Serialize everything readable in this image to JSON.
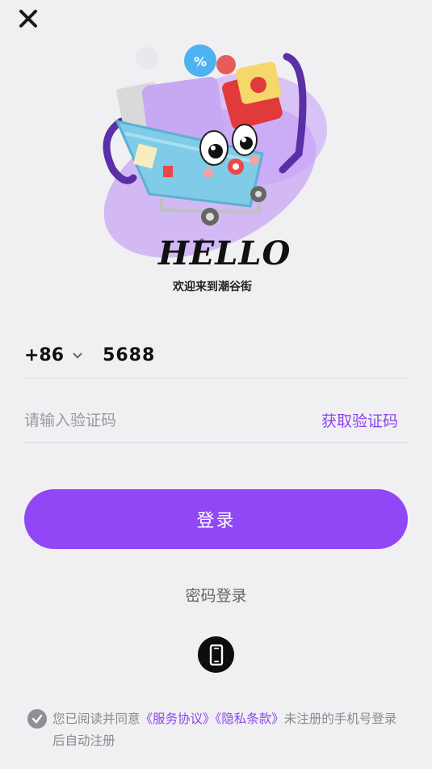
{
  "hero": {
    "hello_word": "HELLO",
    "subtitle": "欢迎来到潮谷街"
  },
  "phone": {
    "country_code": "+86",
    "number": "5688"
  },
  "code": {
    "placeholder": "请输入验证码",
    "get_code_label": "获取验证码"
  },
  "login": {
    "label": "登录"
  },
  "password_login": {
    "label": "密码登录"
  },
  "agreement": {
    "prefix": "您已阅读并同意",
    "service_link": "《服务协议》",
    "privacy_link": "《隐私条款》",
    "suffix": "未注册的手机号登录后自动注册"
  },
  "colors": {
    "accent": "#9147f5",
    "link": "#8d45ef",
    "background": "#f0f0f2"
  }
}
